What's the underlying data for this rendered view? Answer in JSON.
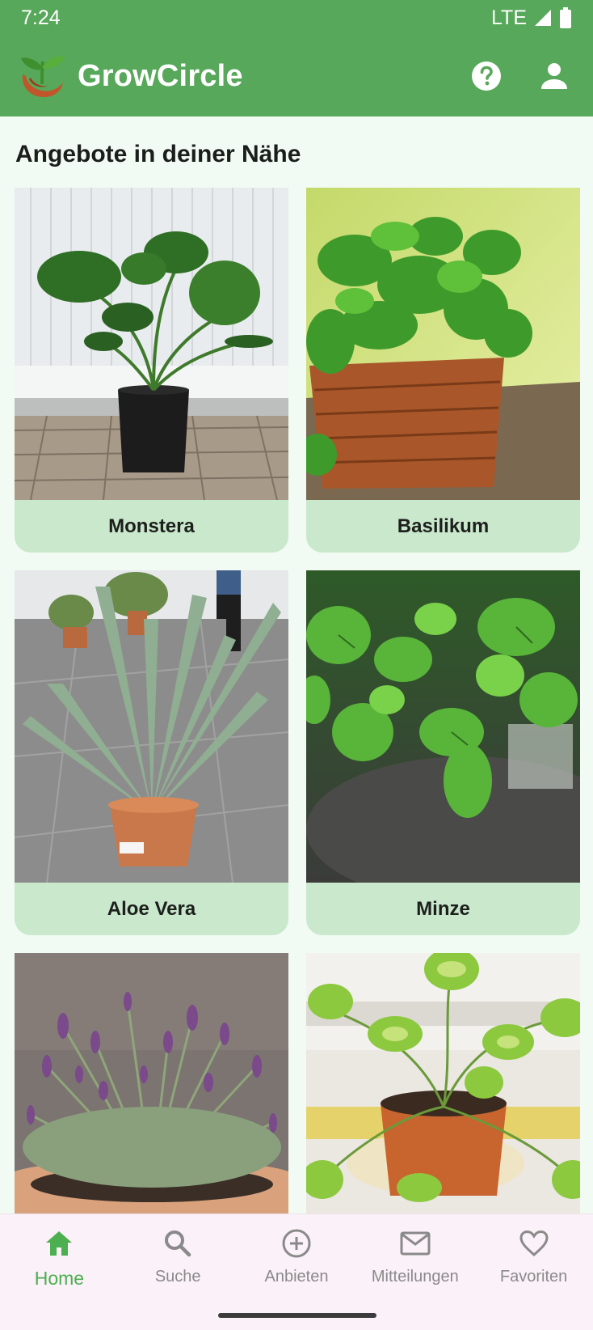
{
  "status": {
    "time": "7:24",
    "network": "LTE"
  },
  "app": {
    "title": "GrowCircle",
    "accent": "#57a85a"
  },
  "main": {
    "section_title": "Angebote in deiner Nähe",
    "offers": [
      {
        "name": "Monstera"
      },
      {
        "name": "Basilikum"
      },
      {
        "name": "Aloe Vera"
      },
      {
        "name": "Minze"
      },
      {
        "name": ""
      },
      {
        "name": ""
      }
    ]
  },
  "nav": {
    "items": [
      {
        "label": "Home",
        "icon": "home-icon",
        "active": true
      },
      {
        "label": "Suche",
        "icon": "search-icon"
      },
      {
        "label": "Anbieten",
        "icon": "add-circle-icon"
      },
      {
        "label": "Mitteilungen",
        "icon": "mail-icon"
      },
      {
        "label": "Favoriten",
        "icon": "heart-icon"
      }
    ]
  }
}
